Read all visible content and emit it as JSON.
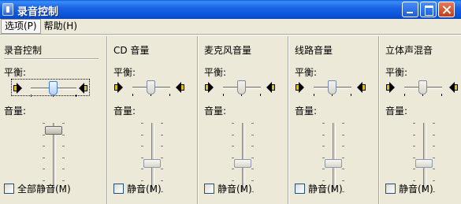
{
  "window": {
    "title": "录音控制"
  },
  "menu": [
    {
      "label": "选项(P)"
    },
    {
      "label": "帮助(H)"
    }
  ],
  "labels": {
    "balance": "平衡:",
    "volume": "音量:"
  },
  "columns": [
    {
      "title": "录音控制",
      "mute_label": "全部静音(M)",
      "volume_level": 0.95,
      "balance_level": 0.5,
      "focused": true
    },
    {
      "title": "CD 音量",
      "mute_label": "静音(M)",
      "volume_level": 0.4,
      "balance_level": 0.5,
      "focused": false
    },
    {
      "title": "麦克风音量",
      "mute_label": "静音(M)",
      "volume_level": 0.4,
      "balance_level": 0.5,
      "focused": false
    },
    {
      "title": "线路音量",
      "mute_label": "静音(M)",
      "volume_level": 0.4,
      "balance_level": 0.5,
      "focused": false
    },
    {
      "title": "立体声混音",
      "mute_label": "静音(M)",
      "volume_level": 0.4,
      "balance_level": 0.5,
      "focused": false
    }
  ]
}
